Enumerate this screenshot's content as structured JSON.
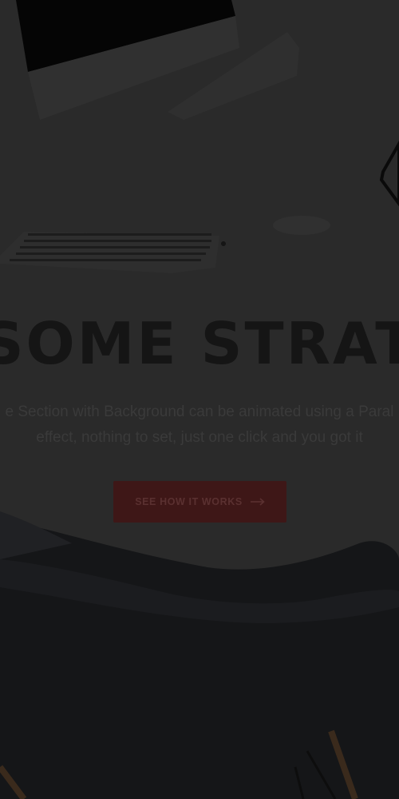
{
  "hero": {
    "headline": "SOME STRAT",
    "description_line1": "e Section with Background can be animated using a Paral",
    "description_line2": "effect, nothing to set, just one click and you got it",
    "cta_label": "SEE HOW IT WORKS",
    "cta_icon": "arrow-right-icon"
  },
  "colors": {
    "overlay_background": "#262626",
    "headline": "#151515",
    "description": "#3a3a3a",
    "cta_background": "#3e1717",
    "cta_text": "#5a3030"
  }
}
